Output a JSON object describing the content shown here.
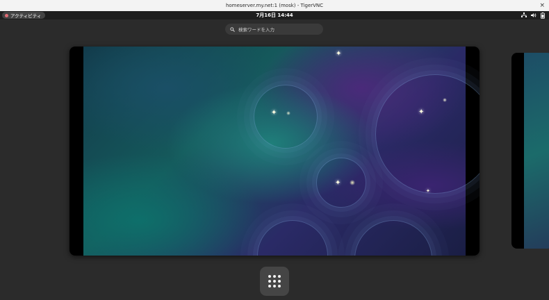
{
  "window": {
    "title": "homeserver.my.net:1 (mosk) - TigerVNC",
    "close_glyph": "×"
  },
  "topbar": {
    "activities_label": "アクティビティ",
    "clock": "7月16日  14:44",
    "tray_icons": [
      "network-icon",
      "volume-icon",
      "battery-icon"
    ]
  },
  "search": {
    "placeholder": "検索ワードを入力",
    "icon": "search-icon"
  },
  "workspaces": {
    "main_wallpaper": "galaxy-wallpaper",
    "side_wallpaper": "galaxy-wallpaper"
  },
  "dash": {
    "app_grid_icon": "app-grid-icon"
  },
  "colors": {
    "panel": "#1e1e1e",
    "overview_bg": "#2b2b2b",
    "activities_dot": "#e06c75"
  }
}
